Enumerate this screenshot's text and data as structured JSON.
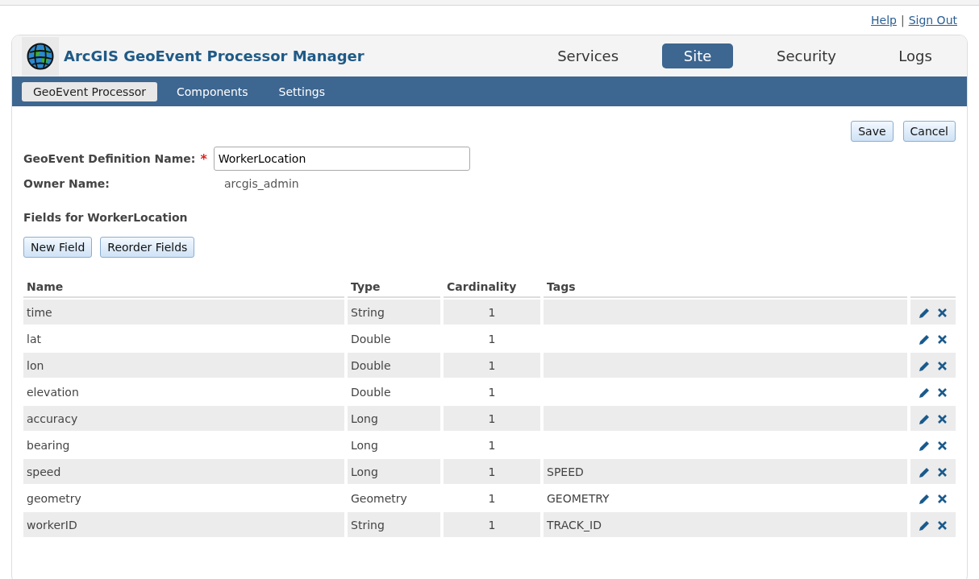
{
  "top_links": [
    {
      "label": "Help"
    },
    {
      "label": "Sign Out"
    }
  ],
  "top_separator": "|",
  "app": {
    "title": "ArcGIS GeoEvent Processor Manager"
  },
  "main_tabs": [
    {
      "label": "Services",
      "selected": false
    },
    {
      "label": "Site",
      "selected": true
    },
    {
      "label": "Security",
      "selected": false
    },
    {
      "label": "Logs",
      "selected": false
    }
  ],
  "sub_tabs": [
    {
      "label": "GeoEvent Processor",
      "selected": true
    },
    {
      "label": "Components",
      "selected": false
    },
    {
      "label": "Settings",
      "selected": false
    }
  ],
  "actions": [
    "Save",
    "Cancel"
  ],
  "form": {
    "definition_label": "GeoEvent Definition Name:",
    "required_mark": "*",
    "definition_value": "WorkerLocation",
    "owner_label": "Owner Name:",
    "owner_value": "arcgis_admin"
  },
  "fields_heading": "Fields for WorkerLocation",
  "field_buttons": [
    "New Field",
    "Reorder Fields"
  ],
  "table": {
    "columns": [
      "Name",
      "Type",
      "Cardinality",
      "Tags"
    ],
    "rows": [
      {
        "cells": [
          "time",
          "String",
          "1",
          ""
        ]
      },
      {
        "cells": [
          "lat",
          "Double",
          "1",
          ""
        ]
      },
      {
        "cells": [
          "lon",
          "Double",
          "1",
          ""
        ]
      },
      {
        "cells": [
          "elevation",
          "Double",
          "1",
          ""
        ]
      },
      {
        "cells": [
          "accuracy",
          "Long",
          "1",
          ""
        ]
      },
      {
        "cells": [
          "bearing",
          "Long",
          "1",
          ""
        ]
      },
      {
        "cells": [
          "speed",
          "Long",
          "1",
          "SPEED"
        ]
      },
      {
        "cells": [
          "geometry",
          "Geometry",
          "1",
          "GEOMETRY"
        ]
      },
      {
        "cells": [
          "workerID",
          "String",
          "1",
          "TRACK_ID"
        ]
      }
    ]
  }
}
